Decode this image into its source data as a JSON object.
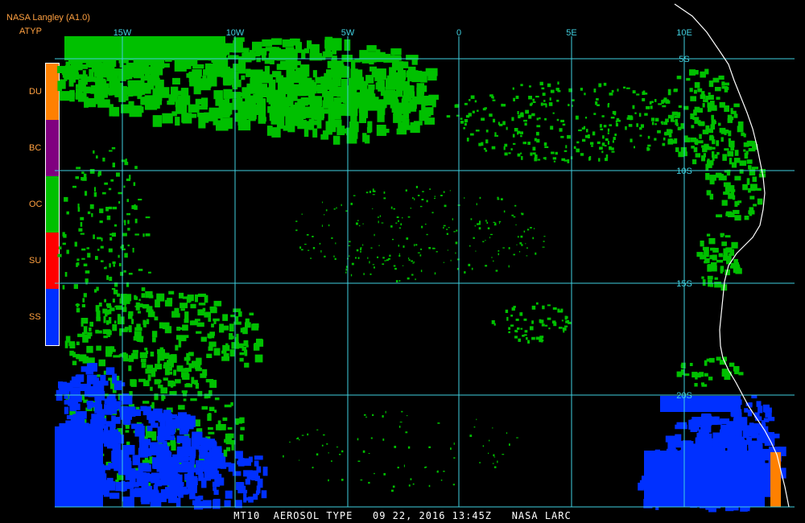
{
  "header": {
    "title": "NASA Langley (A1.0)",
    "subtitle": "ATYP"
  },
  "legend": {
    "items": [
      {
        "label": "DU",
        "color": "#ff8000"
      },
      {
        "label": "BC",
        "color": "#800080"
      },
      {
        "label": "OC",
        "color": "#00c000"
      },
      {
        "label": "SU",
        "color": "#ff0000"
      },
      {
        "label": "SS",
        "color": "#0030ff"
      }
    ]
  },
  "map": {
    "longitude_labels": [
      "15W",
      "10W",
      "5W",
      "0",
      "5E",
      "10E"
    ],
    "latitude_labels": [
      "5S",
      "10S",
      "15S",
      "20S"
    ],
    "grid_color": "#40d0e0",
    "coast_color": "#ffffff"
  },
  "footer": {
    "text": "MT10  AEROSOL TYPE   09 22, 2016 13:45Z   NASA LARC"
  }
}
